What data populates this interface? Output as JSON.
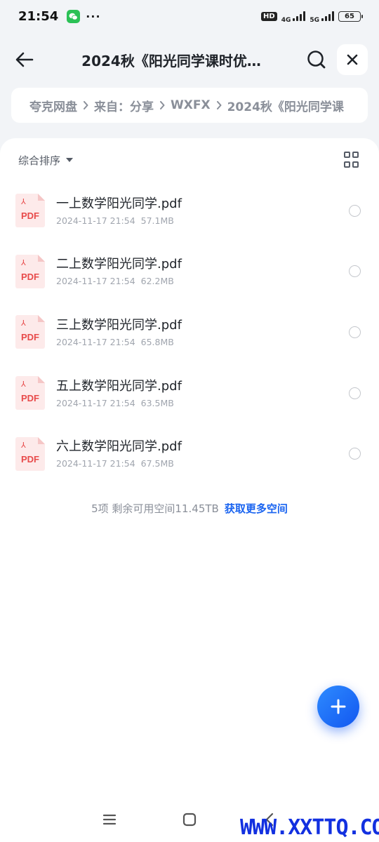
{
  "status_bar": {
    "time": "21:54",
    "more": "···",
    "hd": "HD",
    "net1": "4G",
    "net2": "5G",
    "battery": "65"
  },
  "header": {
    "title": "2024秋《阳光同学课时优…"
  },
  "breadcrumb": {
    "items": [
      "夸克网盘",
      "来自：分享",
      "WXFX",
      "2024秋《阳光同学课"
    ]
  },
  "sort": {
    "label": "综合排序"
  },
  "files": [
    {
      "name": "一上数学阳光同学.pdf",
      "date": "2024-11-17 21:54",
      "size": "57.1MB",
      "type": "PDF"
    },
    {
      "name": "二上数学阳光同学.pdf",
      "date": "2024-11-17 21:54",
      "size": "62.2MB",
      "type": "PDF"
    },
    {
      "name": "三上数学阳光同学.pdf",
      "date": "2024-11-17 21:54",
      "size": "65.8MB",
      "type": "PDF"
    },
    {
      "name": "五上数学阳光同学.pdf",
      "date": "2024-11-17 21:54",
      "size": "63.5MB",
      "type": "PDF"
    },
    {
      "name": "六上数学阳光同学.pdf",
      "date": "2024-11-17 21:54",
      "size": "67.5MB",
      "type": "PDF"
    }
  ],
  "storage": {
    "summary": "5项 剩余可用空间11.45TB",
    "link": "获取更多空间"
  },
  "watermark": "WWW.XXTTQ.COM",
  "colors": {
    "accent": "#1a64f0",
    "pdf_red": "#e84b4b",
    "background": "#f2f4f7"
  }
}
